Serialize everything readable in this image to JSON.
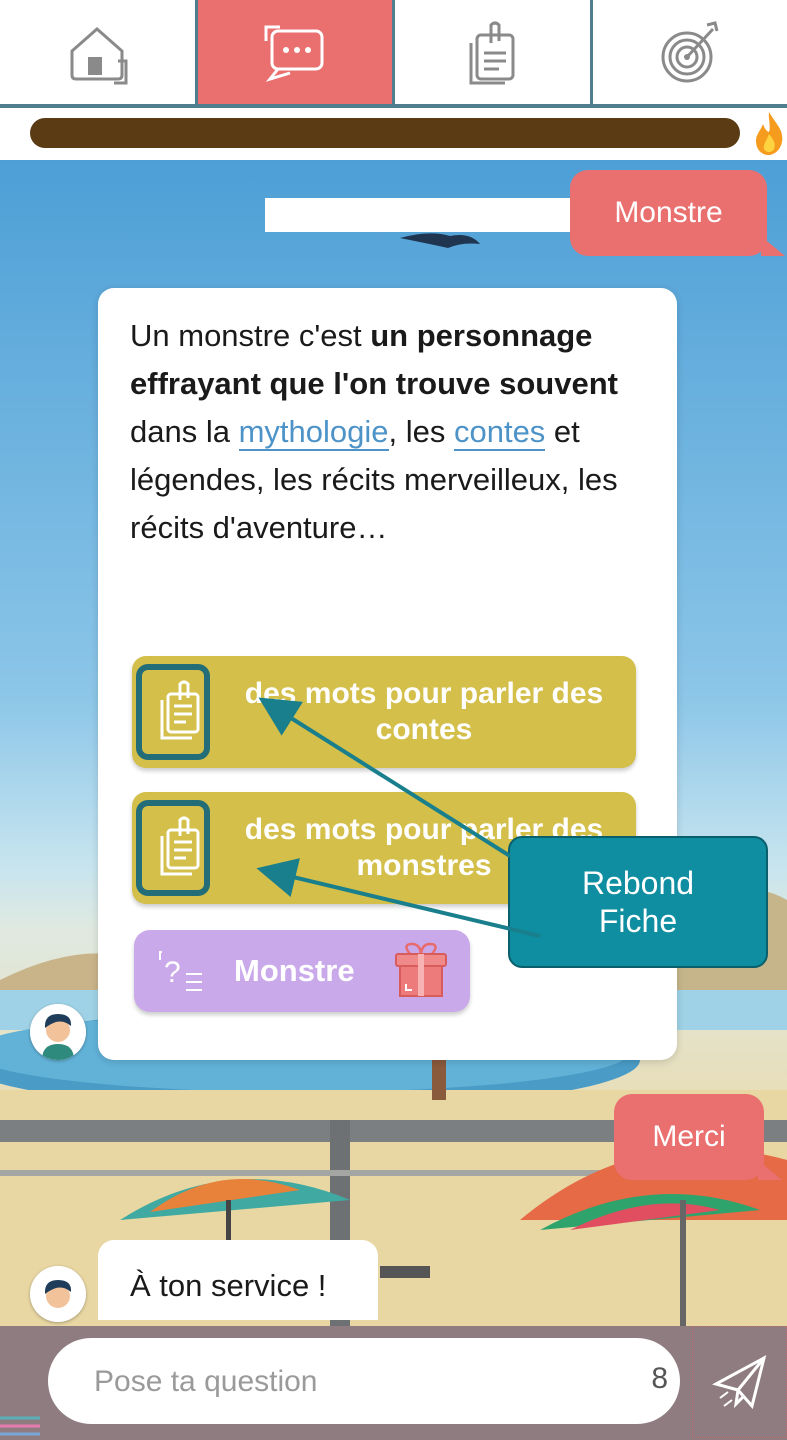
{
  "nav": {
    "tabs": [
      {
        "name": "home",
        "icon": "home-icon",
        "active": false
      },
      {
        "name": "chat",
        "icon": "chat-icon",
        "active": true
      },
      {
        "name": "sheets",
        "icon": "clipboard-icon",
        "active": false
      },
      {
        "name": "goals",
        "icon": "target-icon",
        "active": false
      }
    ]
  },
  "progress": {
    "color": "#5a3b14",
    "icon": "flame-icon"
  },
  "conversation": {
    "user_message_1": "Monstre",
    "bot_answer": {
      "parts": [
        {
          "text": "Un monstre c'est ",
          "style": "normal"
        },
        {
          "text": "un personnage effrayant que l'on trouve souvent",
          "style": "bold"
        },
        {
          "text": " dans la ",
          "style": "normal"
        },
        {
          "text": "mythologie",
          "style": "link"
        },
        {
          "text": ", les ",
          "style": "normal"
        },
        {
          "text": "contes",
          "style": "link"
        },
        {
          "text": " et légendes, les récits merveilleux, les récits d'aventure…",
          "style": "normal"
        }
      ]
    },
    "rebond_buttons": [
      {
        "label_line1": "des mots pour parler des",
        "label_line2": "contes",
        "icon": "clipboard-icon"
      },
      {
        "label_line1": "des mots pour parler des",
        "label_line2": "monstres",
        "icon": "clipboard-icon"
      }
    ],
    "quiz_button": {
      "label": "Monstre",
      "icon": "quiz-icon",
      "badge_icon": "gift-icon"
    },
    "user_message_2": "Merci",
    "bot_reply": "À ton service !"
  },
  "annotation": {
    "line1": "Rebond",
    "line2": "Fiche"
  },
  "input": {
    "placeholder": "Pose ta question",
    "counter": "8",
    "send_icon": "paper-plane-icon"
  },
  "colors": {
    "accent_red": "#ea6f6f",
    "nav_border": "#4f7f8e",
    "rebond_yellow": "#d3bf4a",
    "quiz_purple": "#c9a9ea",
    "annotation_teal": "#0e8ea0",
    "link_blue": "#4d93c8"
  }
}
